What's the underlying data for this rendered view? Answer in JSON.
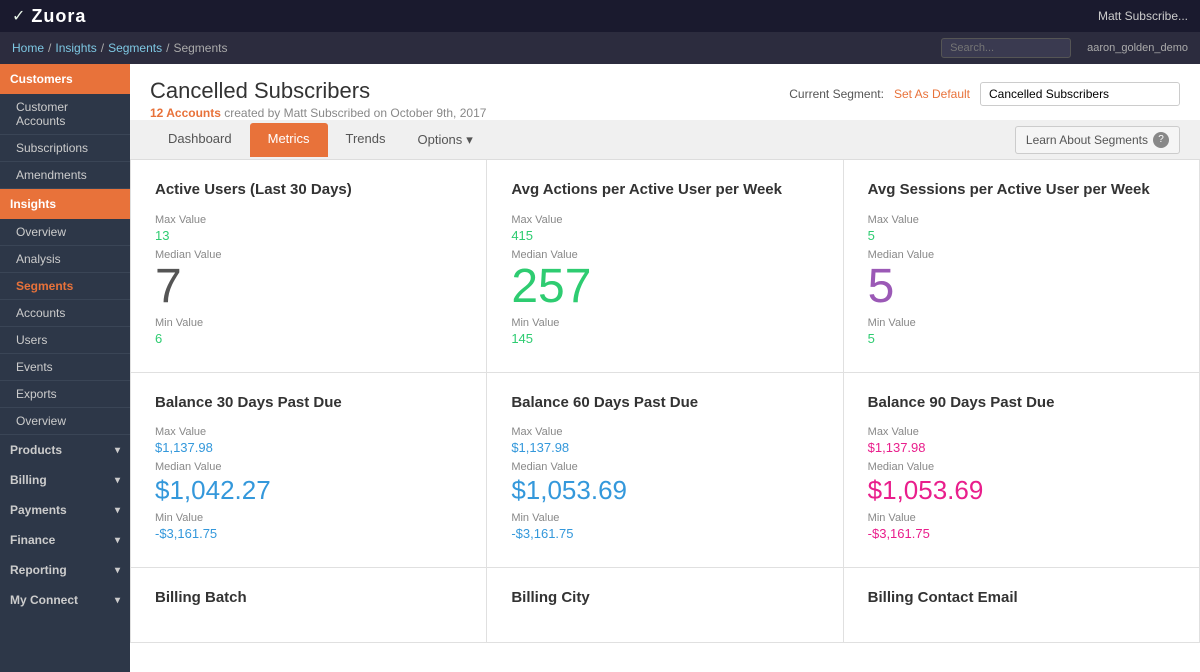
{
  "app": {
    "logo": "Zuora",
    "logo_icon": "✓"
  },
  "topbar": {
    "user": "Matt Subscribe...",
    "user_account": "aaron_golden_demo"
  },
  "breadcrumb": {
    "items": [
      "Home",
      "Insights",
      "Segments",
      "Segments"
    ]
  },
  "search": {
    "placeholder": "Search..."
  },
  "sidebar": {
    "groups": [
      {
        "label": "Customers",
        "active": true,
        "items": [
          {
            "label": "Customer Accounts",
            "active": false
          },
          {
            "label": "Subscriptions",
            "active": false
          },
          {
            "label": "Amendments",
            "active": false
          }
        ]
      },
      {
        "label": "Insights",
        "active": true,
        "items": [
          {
            "label": "Overview",
            "active": false
          },
          {
            "label": "Analysis",
            "active": false
          },
          {
            "label": "Segments",
            "active": true
          },
          {
            "label": "Accounts",
            "active": false
          },
          {
            "label": "Users",
            "active": false
          },
          {
            "label": "Events",
            "active": false
          },
          {
            "label": "Exports",
            "active": false
          },
          {
            "label": "Overview",
            "active": false
          }
        ]
      },
      {
        "label": "Products",
        "active": false,
        "items": []
      },
      {
        "label": "Billing",
        "active": false,
        "items": []
      },
      {
        "label": "Payments",
        "active": false,
        "items": []
      },
      {
        "label": "Finance",
        "active": false,
        "items": []
      },
      {
        "label": "Reporting",
        "active": false,
        "items": []
      },
      {
        "label": "My Connect",
        "active": false,
        "items": []
      }
    ]
  },
  "page": {
    "title": "Cancelled Subscribers",
    "subtitle_count": "12 Accounts",
    "subtitle_text": " created by Matt Subscribed on October 9th, 2017"
  },
  "segment": {
    "current_label": "Current Segment:",
    "set_as_default": "Set As Default",
    "value": "Cancelled Subscribers"
  },
  "tabs": {
    "items": [
      "Dashboard",
      "Metrics",
      "Trends"
    ],
    "dropdown": "Options",
    "active": "Metrics",
    "learn_label": "Learn About Segments"
  },
  "metrics": [
    {
      "title": "Active Users (Last 30 Days)",
      "max_label": "Max Value",
      "max_value": "13",
      "max_color": "green",
      "median_label": "Median Value",
      "median_value": "7",
      "median_color": "large",
      "min_label": "Min Value",
      "min_value": "6",
      "min_color": "green"
    },
    {
      "title": "Avg Actions per Active User per Week",
      "max_label": "Max Value",
      "max_value": "415",
      "max_color": "green",
      "median_label": "Median Value",
      "median_value": "257",
      "median_color": "large-green",
      "min_label": "Min Value",
      "min_value": "145",
      "min_color": "green"
    },
    {
      "title": "Avg Sessions per Active User per Week",
      "max_label": "Max Value",
      "max_value": "5",
      "max_color": "green",
      "median_label": "Median Value",
      "median_value": "5",
      "median_color": "large-purple",
      "min_label": "Min Value",
      "min_value": "5",
      "min_color": "green"
    },
    {
      "title": "Balance 30 Days Past Due",
      "max_label": "Max Value",
      "max_value": "$1,137.98",
      "max_color": "blue",
      "median_label": "Median Value",
      "median_value": "$1,042.27",
      "median_color": "blue",
      "min_label": "Min Value",
      "min_value": "-$3,161.75",
      "min_color": "blue"
    },
    {
      "title": "Balance 60 Days Past Due",
      "max_label": "Max Value",
      "max_value": "$1,137.98",
      "max_color": "blue",
      "median_label": "Median Value",
      "median_value": "$1,053.69",
      "median_color": "blue",
      "min_label": "Min Value",
      "min_value": "-$3,161.75",
      "min_color": "blue"
    },
    {
      "title": "Balance 90 Days Past Due",
      "max_label": "Max Value",
      "max_value": "$1,137.98",
      "max_color": "pink",
      "median_label": "Median Value",
      "median_value": "$1,053.69",
      "median_color": "pink",
      "min_label": "Min Value",
      "min_value": "-$3,161.75",
      "min_color": "pink"
    },
    {
      "title": "Billing Batch",
      "max_label": "",
      "max_value": "",
      "max_color": "",
      "median_label": "",
      "median_value": "",
      "median_color": "",
      "min_label": "",
      "min_value": "",
      "min_color": ""
    },
    {
      "title": "Billing City",
      "max_label": "",
      "max_value": "",
      "max_color": "",
      "median_label": "",
      "median_value": "",
      "median_color": "",
      "min_label": "",
      "min_value": "",
      "min_color": ""
    },
    {
      "title": "Billing Contact Email",
      "max_label": "",
      "max_value": "",
      "max_color": "",
      "median_label": "",
      "median_value": "",
      "median_color": "",
      "min_label": "",
      "min_value": "",
      "min_color": ""
    }
  ]
}
